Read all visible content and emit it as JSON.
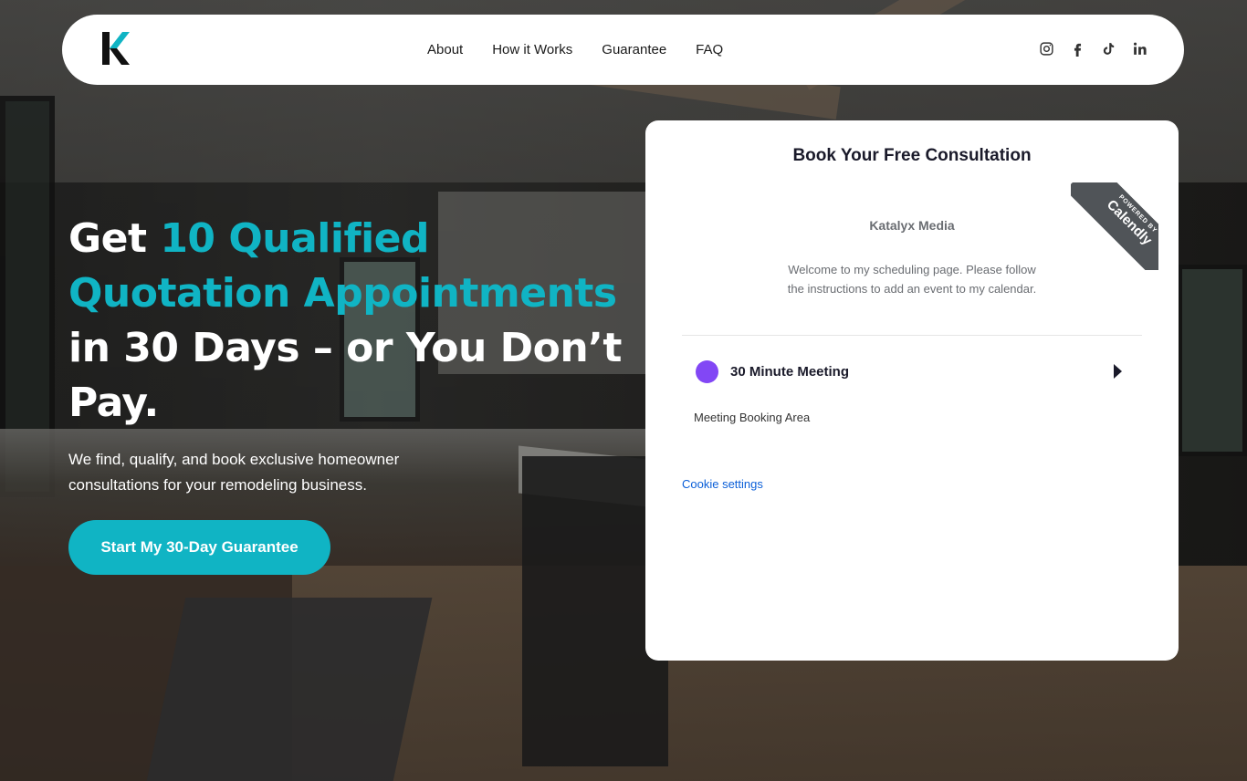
{
  "nav": {
    "logo_icon": "katalyx-k-logo",
    "links": [
      "About",
      "How it Works",
      "Guarantee",
      "FAQ"
    ],
    "socials": [
      "instagram-icon",
      "facebook-icon",
      "tiktok-icon",
      "linkedin-icon"
    ]
  },
  "hero": {
    "title_part1": "Get ",
    "title_accent": "10 Qualified Quotation Appointments",
    "title_part2": " in 30 Days – or You Don’t Pay.",
    "subtitle": "We find, qualify, and book exclusive homeowner consultations for your remodeling business.",
    "cta_label": "Start My 30-Day Guarantee"
  },
  "booking": {
    "title": "Book Your Free Consultation",
    "ribbon_small": "POWERED BY",
    "ribbon_brand": "Calendly",
    "org_name": "Katalyx Media",
    "welcome": "Welcome to my scheduling page. Please follow the instructions to add an event to my calendar.",
    "event_name": "30 Minute Meeting",
    "booking_area": "Meeting Booking Area",
    "cookie_settings": "Cookie settings"
  },
  "colors": {
    "accent": "#10b4c4",
    "event_dot": "#8247f5",
    "link": "#0b5fd8"
  }
}
